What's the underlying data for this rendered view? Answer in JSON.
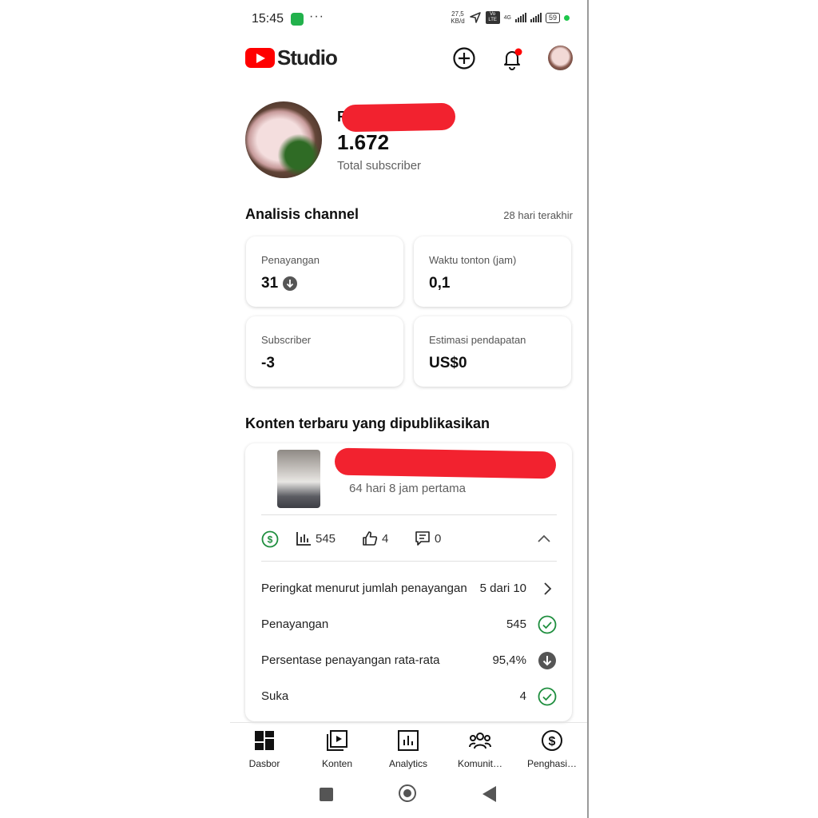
{
  "status_bar": {
    "time": "15:45",
    "dots": "···",
    "speed_top": "27,5",
    "speed_bottom": "KB/d",
    "volte": "Vo LTE",
    "net": "4G",
    "battery": "59"
  },
  "header": {
    "logo_text": "Studio",
    "create_icon": "add-circle-icon",
    "notification_icon": "bell-icon",
    "notification_dot_color": "#ff0000"
  },
  "channel": {
    "name_initial": "R",
    "subscriber_count": "1.672",
    "subscriber_label": "Total subscriber"
  },
  "analytics": {
    "title": "Analisis channel",
    "period": "28 hari terakhir",
    "cards": [
      {
        "label": "Penayangan",
        "value": "31",
        "trend": "down"
      },
      {
        "label": "Waktu tonton (jam)",
        "value": "0,1"
      },
      {
        "label": "Subscriber",
        "value": "-3"
      },
      {
        "label": "Estimasi pendapatan",
        "value": "US$0"
      }
    ]
  },
  "latest": {
    "title": "Konten terbaru yang dipublikasikan",
    "video_subtitle": "64 hari 8 jam pertama",
    "views": "545",
    "likes": "4",
    "comments": "0",
    "monetization_color": "#1e8e3e",
    "metrics": [
      {
        "name": "Peringkat menurut jumlah penayangan",
        "value": "5 dari 10",
        "icon": "chevron-right-icon"
      },
      {
        "name": "Penayangan",
        "value": "545",
        "icon": "check-circle-icon"
      },
      {
        "name": "Persentase penayangan rata-rata",
        "value": "95,4%",
        "icon": "arrow-down-circle-icon"
      },
      {
        "name": "Suka",
        "value": "4",
        "icon": "check-circle-icon"
      }
    ]
  },
  "bottom_nav": [
    {
      "label": "Dasbor",
      "icon": "dashboard-icon"
    },
    {
      "label": "Konten",
      "icon": "content-icon"
    },
    {
      "label": "Analytics",
      "icon": "analytics-icon"
    },
    {
      "label": "Komunit…",
      "icon": "community-icon"
    },
    {
      "label": "Penghasi…",
      "icon": "earn-icon"
    }
  ]
}
